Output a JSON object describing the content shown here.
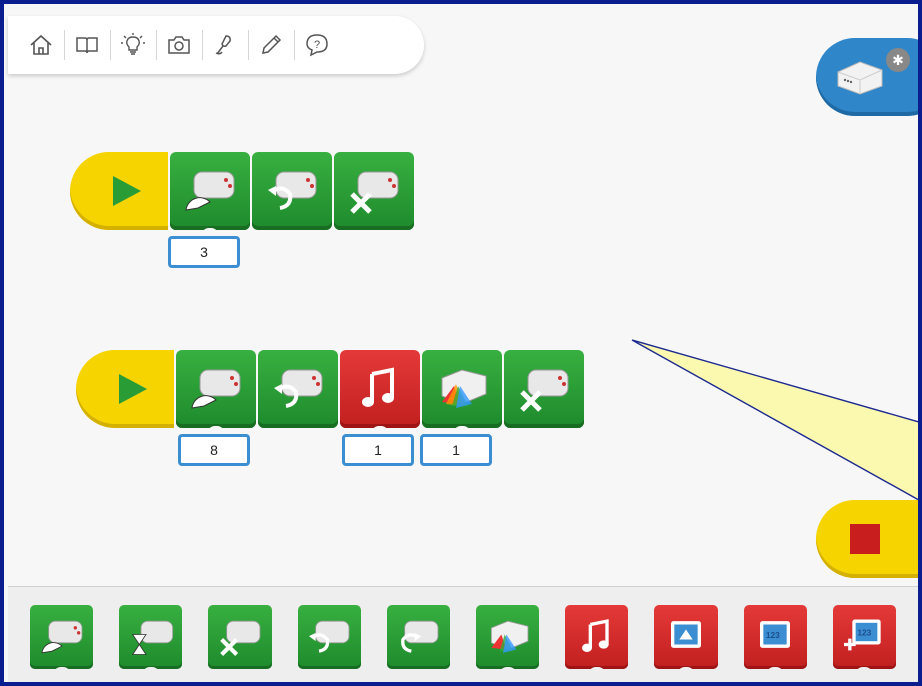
{
  "toolbar": {
    "icons": [
      "home-icon",
      "book-icon",
      "lightbulb-icon",
      "camera-icon",
      "microphone-icon",
      "pencil-icon",
      "help-icon"
    ]
  },
  "hub": {
    "status_icon": "bluetooth-icon"
  },
  "programs": [
    {
      "blocks": [
        {
          "type": "motor-speed",
          "param": "3"
        },
        {
          "type": "motor-direction"
        },
        {
          "type": "motor-off"
        }
      ]
    },
    {
      "blocks": [
        {
          "type": "motor-speed",
          "param": "8"
        },
        {
          "type": "motor-direction"
        },
        {
          "type": "play-sound",
          "param": "1"
        },
        {
          "type": "hub-light",
          "param": "1"
        },
        {
          "type": "motor-off"
        }
      ]
    }
  ],
  "palette": {
    "green_blocks": [
      "motor-speed",
      "motor-on-for",
      "motor-off",
      "motor-direction-ccw",
      "motor-direction-cw",
      "hub-light"
    ],
    "red_blocks": [
      "play-sound",
      "display-background",
      "display-number",
      "add-to-display"
    ],
    "display_number_text": "123"
  },
  "colors": {
    "accent_green": "#2a9c36",
    "accent_red": "#d42a2a",
    "start_yellow": "#f5d400",
    "hub_blue": "#2f86c9",
    "border": "#0a1e8f"
  }
}
